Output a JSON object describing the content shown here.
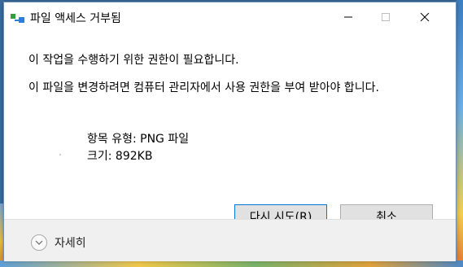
{
  "dialog": {
    "title": "파일 액세스 거부됨",
    "message_primary": "이 작업을 수행하기 위한 권한이 필요합니다.",
    "message_secondary": "이 파일을 변경하려면 컴퓨터 관리자에서 사용 권한을 부여 받아야 합니다.",
    "file_info": {
      "type_line": "항목 유형: PNG 파일",
      "size_line": "크기: 892KB"
    },
    "buttons": {
      "retry_label": "다시 시도(R)",
      "cancel_label": "취소"
    },
    "details_label": "자세히"
  },
  "window_controls": {
    "minimize_icon": "minimize-icon",
    "maximize_icon": "maximize-icon",
    "close_icon": "close-icon"
  },
  "colors": {
    "focus_border": "#0078d7",
    "button_bg": "#e1e1e1",
    "footer_bg": "#f0f0f0"
  }
}
